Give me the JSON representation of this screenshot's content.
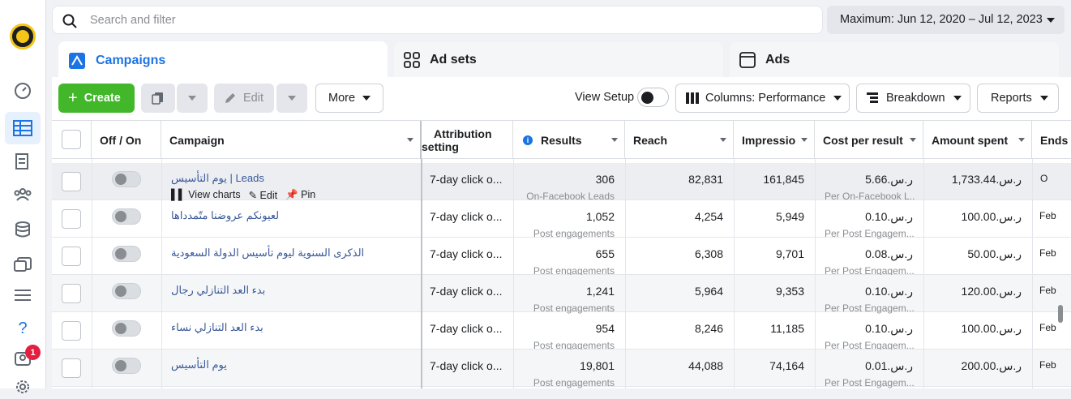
{
  "search": {
    "placeholder": "Search and filter"
  },
  "date_range": "Maximum: Jun 12, 2020 – Jul 12, 2023",
  "nav": {
    "notification_count": "1"
  },
  "tabs": [
    {
      "label": "Campaigns",
      "active": true
    },
    {
      "label": "Ad sets",
      "active": false
    },
    {
      "label": "Ads",
      "active": false
    }
  ],
  "toolbar": {
    "create": "Create",
    "edit": "Edit",
    "more": "More",
    "view_setup": "View Setup",
    "columns": "Columns: Performance",
    "breakdown": "Breakdown",
    "reports": "Reports"
  },
  "columns": {
    "toggle": "Off / On",
    "campaign": "Campaign",
    "attribution_line1": "Attribution",
    "attribution_line2": "setting",
    "results": "Results",
    "reach": "Reach",
    "impressions": "Impressio",
    "cost_per_result": "Cost per result",
    "amount_spent": "Amount spent",
    "ends": "Ends"
  },
  "row_actions": {
    "view_charts": "View charts",
    "edit": "Edit",
    "pin": "Pin"
  },
  "rows": [
    {
      "campaign": "يوم التأسيس | Leads",
      "attribution": "7-day click o...",
      "results": "306",
      "results_type": "On-Facebook Leads",
      "reach": "82,831",
      "impressions": "161,845",
      "cost": "ر.س.5.66",
      "cost_type": "Per On-Facebook L...",
      "spent": "ر.س.1,733.44",
      "ends": "O"
    },
    {
      "campaign": "لعيونكم عروضنا متّمدداها",
      "attribution": "7-day click o...",
      "results": "1,052",
      "results_type": "Post engagements",
      "reach": "4,254",
      "impressions": "5,949",
      "cost": "ر.س.0.10",
      "cost_type": "Per Post Engagem...",
      "spent": "ر.س.100.00",
      "ends": "Feb"
    },
    {
      "campaign": "الذكرى السنوية ليوم تأسيس الدولة السعودية",
      "attribution": "7-day click o...",
      "results": "655",
      "results_type": "Post engagements",
      "reach": "6,308",
      "impressions": "9,701",
      "cost": "ر.س.0.08",
      "cost_type": "Per Post Engagem...",
      "spent": "ر.س.50.00",
      "ends": "Feb"
    },
    {
      "campaign": "بدء العد التنازلي رجال",
      "attribution": "7-day click o...",
      "results": "1,241",
      "results_type": "Post engagements",
      "reach": "5,964",
      "impressions": "9,353",
      "cost": "ر.س.0.10",
      "cost_type": "Per Post Engagem...",
      "spent": "ر.س.120.00",
      "ends": "Feb"
    },
    {
      "campaign": "بدء العد التنازلي نساء",
      "attribution": "7-day click o...",
      "results": "954",
      "results_type": "Post engagements",
      "reach": "8,246",
      "impressions": "11,185",
      "cost": "ر.س.0.10",
      "cost_type": "Per Post Engagem...",
      "spent": "ر.س.100.00",
      "ends": "Feb"
    },
    {
      "campaign": "يوم التأسيس",
      "attribution": "7-day click o...",
      "results": "19,801",
      "results_type": "Post engagements",
      "reach": "44,088",
      "impressions": "74,164",
      "cost": "ر.س.0.01",
      "cost_type": "Per Post Engagem...",
      "spent": "ر.س.200.00",
      "ends": "Feb"
    }
  ]
}
